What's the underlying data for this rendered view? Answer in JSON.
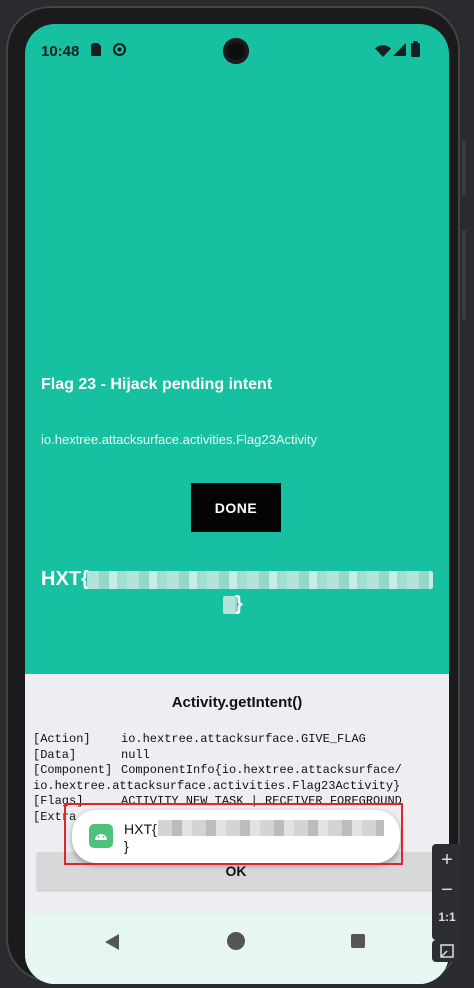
{
  "status_bar": {
    "time": "10:48"
  },
  "app": {
    "title": "Flag 23 - Hijack pending intent",
    "activity": "io.hextree.attacksurface.activities.Flag23Activity",
    "done_label": "DONE",
    "flag_prefix": "HXT{",
    "flag_suffix": "}"
  },
  "sheet": {
    "title": "Activity.getIntent()",
    "rows": [
      {
        "key": "[Action]",
        "value": "io.hextree.attacksurface.GIVE_FLAG"
      },
      {
        "key": "[Data]",
        "value": "null"
      },
      {
        "key": "[Component]",
        "value": "ComponentInfo{io.hextree.attacksurface/"
      },
      {
        "key": "",
        "value": "io.hextree.attacksurface.activities.Flag23Activity}"
      },
      {
        "key": "[Flags]",
        "value": "ACTIVITY_NEW_TASK | RECEIVER_FOREGROUND"
      },
      {
        "key": "[Extra",
        "value": ""
      }
    ],
    "ok_label": "OK"
  },
  "toast": {
    "line1": "HXT{",
    "line2": "}"
  },
  "toolbar": {
    "zoom_in": "+",
    "zoom_out": "−",
    "one_to_one": "1:1"
  },
  "colors": {
    "app_bg": "#17c0a0",
    "sheet_bg": "#eeeef2",
    "highlight": "#e0262a"
  }
}
